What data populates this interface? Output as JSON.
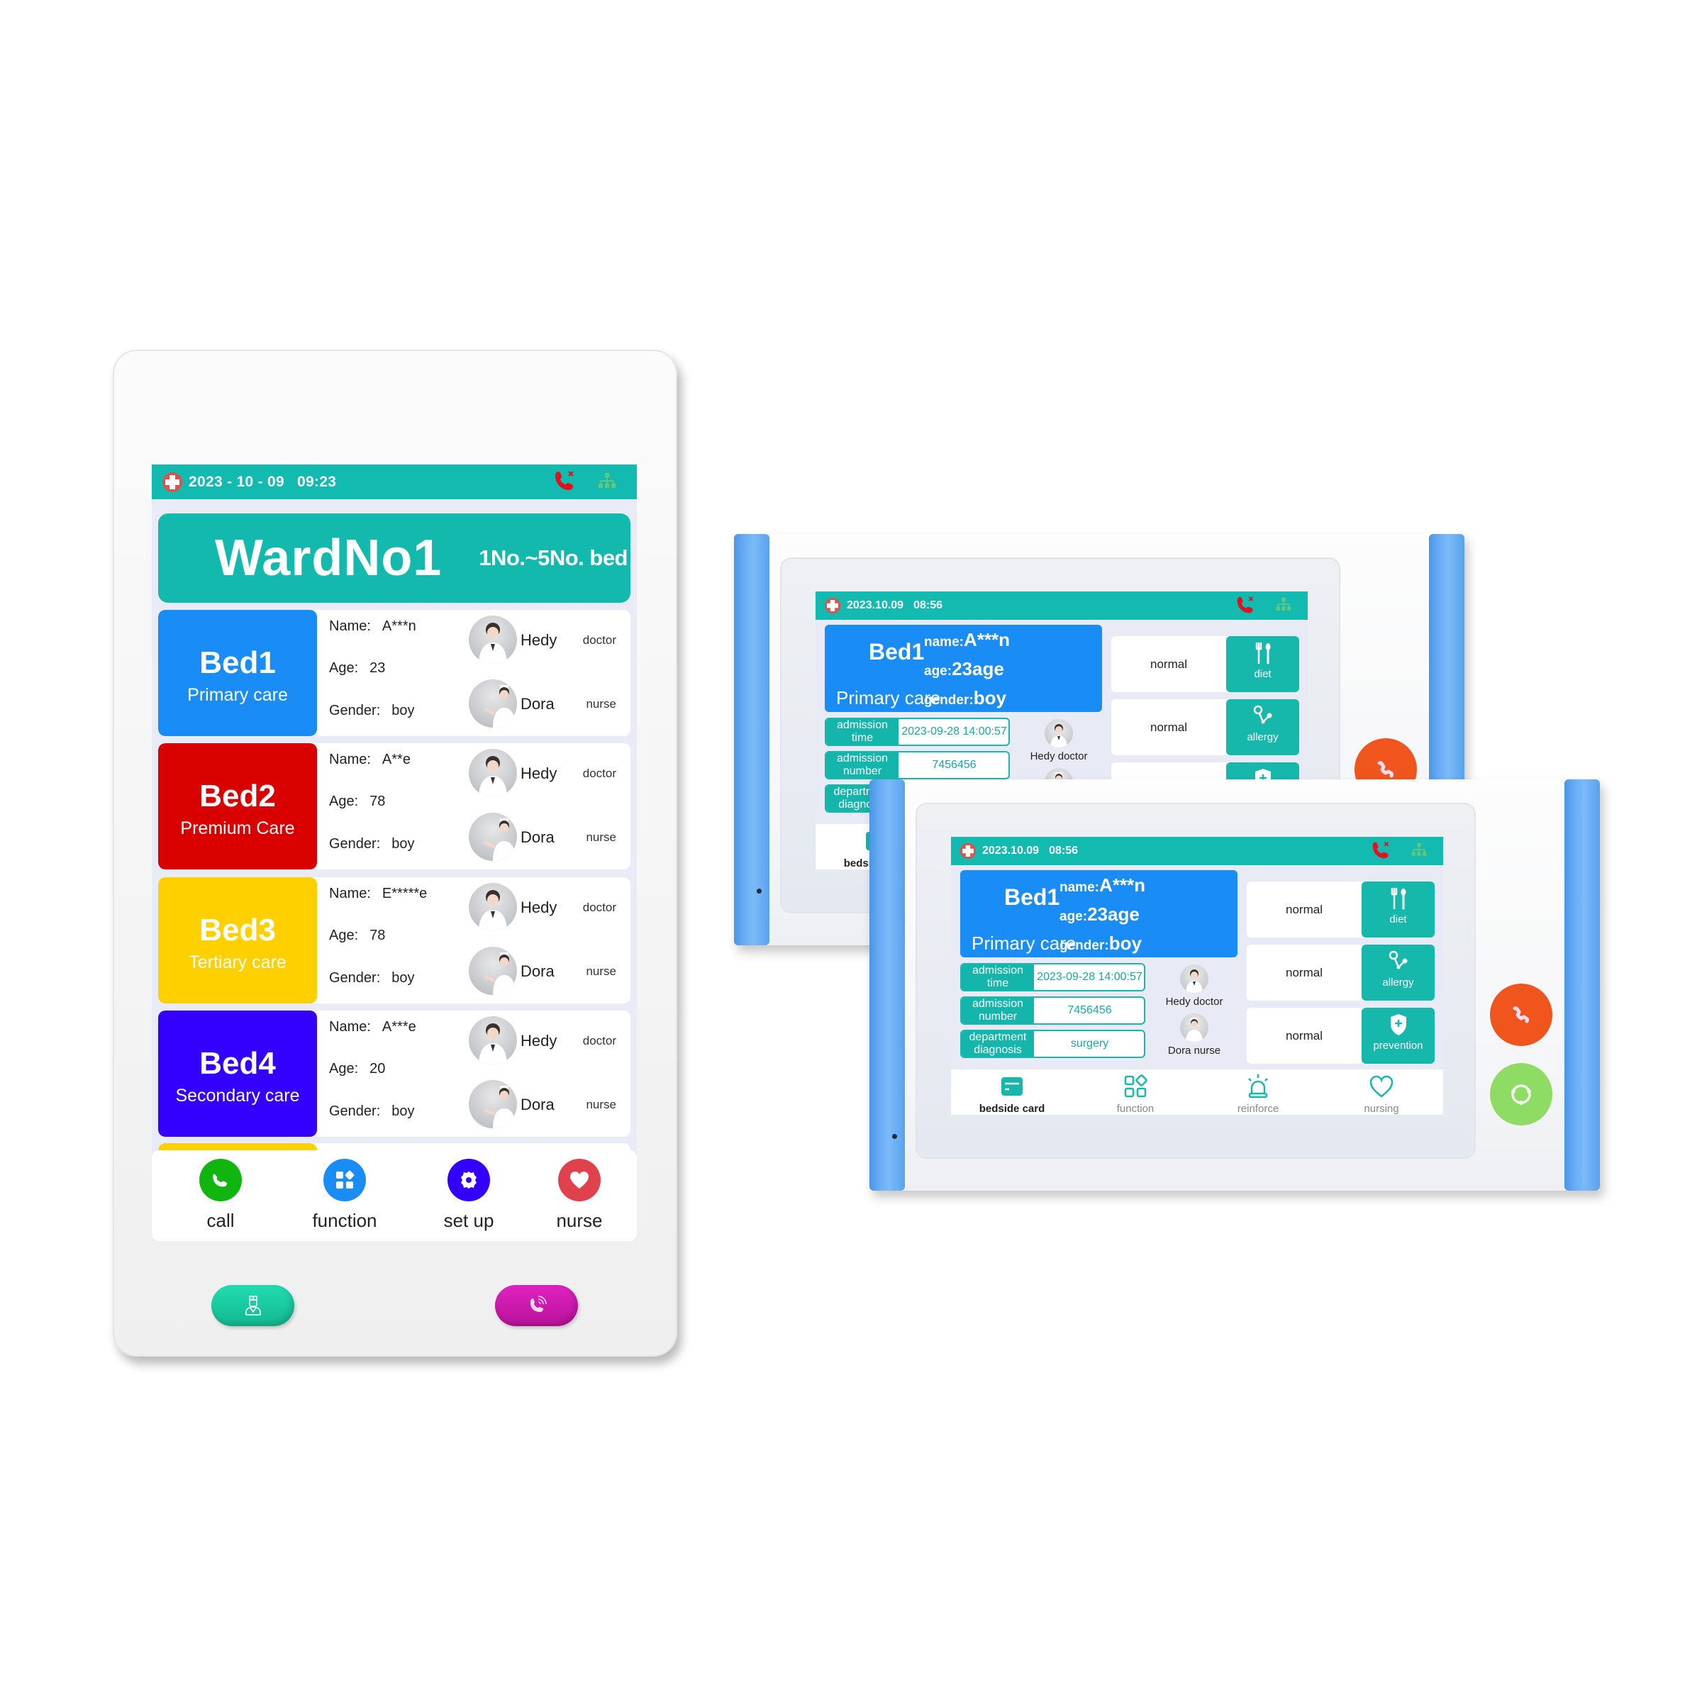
{
  "colors": {
    "teal": "#12bab0",
    "bed_primary": "#1a8cf5",
    "bed_premium": "#d90000",
    "bed_tertiary": "#ffd000",
    "bed_secondary": "#3300ff",
    "call_green": "#10b510",
    "function_blue": "#1a8cf5",
    "setup_purple": "#3300ff",
    "nurse_red": "#e0424d",
    "hangup_orange": "#f0551e",
    "answer_green": "#8fdc64",
    "hw_teal": "#1ed4a6",
    "hw_magenta": "#d41ab0"
  },
  "portrait": {
    "header": {
      "date": "2023 - 10 - 09",
      "time": "09:23",
      "icons": [
        "hospital-cross-icon",
        "call-disconnected-icon",
        "network-icon"
      ]
    },
    "ward": {
      "title": "WardNo1",
      "range": "1No.~5No. bed"
    },
    "beds": [
      {
        "number": "Bed1",
        "care": "Primary care",
        "color": "#1a8cf5",
        "name_label": "Name:",
        "name": "A***n",
        "age_label": "Age:",
        "age": "23",
        "gender_label": "Gender:",
        "gender": "boy",
        "doctor": {
          "name": "Hedy",
          "role": "doctor"
        },
        "nurse": {
          "name": "Dora",
          "role": "nurse"
        }
      },
      {
        "number": "Bed2",
        "care": "Premium Care",
        "color": "#d90000",
        "name_label": "Name:",
        "name": "A**e",
        "age_label": "Age:",
        "age": "78",
        "gender_label": "Gender:",
        "gender": "boy",
        "doctor": {
          "name": "Hedy",
          "role": "doctor"
        },
        "nurse": {
          "name": "Dora",
          "role": "nurse"
        }
      },
      {
        "number": "Bed3",
        "care": "Tertiary care",
        "color": "#ffd000",
        "name_label": "Name:",
        "name": "E*****e",
        "age_label": "Age:",
        "age": "78",
        "gender_label": "Gender:",
        "gender": "boy",
        "doctor": {
          "name": "Hedy",
          "role": "doctor"
        },
        "nurse": {
          "name": "Dora",
          "role": "nurse"
        }
      },
      {
        "number": "Bed4",
        "care": "Secondary care",
        "color": "#3300ff",
        "name_label": "Name:",
        "name": "A***e",
        "age_label": "Age:",
        "age": "20",
        "gender_label": "Gender:",
        "gender": "boy",
        "doctor": {
          "name": "Hedy",
          "role": "doctor"
        },
        "nurse": {
          "name": "Dora",
          "role": "nurse"
        }
      }
    ],
    "nav": [
      {
        "label": "call",
        "icon": "phone-icon",
        "color": "#10b510"
      },
      {
        "label": "function",
        "icon": "grid-apps-icon",
        "color": "#1a8cf5"
      },
      {
        "label": "set up",
        "icon": "gear-icon",
        "color": "#3300ff"
      },
      {
        "label": "nurse",
        "icon": "heart-icon",
        "color": "#e0424d"
      }
    ],
    "hardware_buttons": [
      {
        "icon": "doctor-icon",
        "color": "#1ed4a6"
      },
      {
        "icon": "phone-ringing-icon",
        "color": "#d41ab0"
      }
    ]
  },
  "landscape": {
    "header": {
      "date": "2023.10.09",
      "time": "08:56"
    },
    "card": {
      "bed": "Bed1",
      "care": "Primary care",
      "name_key": "name:",
      "name": "A***n",
      "age_key": "age:",
      "age": "23age",
      "gender_key": "gender:",
      "gender": "boy"
    },
    "info": [
      {
        "key": "admission time",
        "value": "2023-09-28 14:00:57"
      },
      {
        "key": "admission number",
        "value": "7456456"
      },
      {
        "key": "department diagnosis",
        "value": "surgery"
      }
    ],
    "staff": [
      {
        "label": "Hedy  doctor"
      },
      {
        "label": "Dora  nurse"
      }
    ],
    "status": [
      {
        "value": "normal",
        "label": "diet",
        "icon": "fork-spoon-icon"
      },
      {
        "value": "normal",
        "label": "allergy",
        "icon": "allergy-icon"
      },
      {
        "value": "normal",
        "label": "prevention",
        "icon": "shield-plus-icon"
      }
    ],
    "nav": [
      {
        "label": "bedside card",
        "icon": "card-icon",
        "active": true
      },
      {
        "label": "function",
        "icon": "grid-apps-icon",
        "active": false
      },
      {
        "label": "reinforce",
        "icon": "alarm-light-icon",
        "active": false
      },
      {
        "label": "nursing",
        "icon": "heart-outline-icon",
        "active": false
      }
    ],
    "side_buttons": [
      {
        "icon": "hang-up-icon",
        "color": "#f0551e"
      },
      {
        "icon": "answer-icon",
        "color": "#8fdc64"
      }
    ]
  }
}
